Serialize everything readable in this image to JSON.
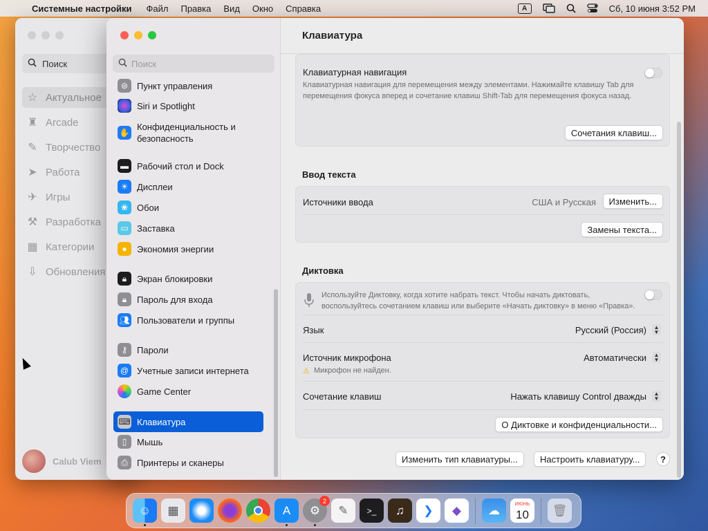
{
  "menubar": {
    "app_name": "Системные настройки",
    "menus": [
      "Файл",
      "Правка",
      "Вид",
      "Окно",
      "Справка"
    ],
    "input_indicator": "A",
    "datetime": "Сб, 10 июня  3:52 PM"
  },
  "bg_window": {
    "search_label": "Поиск",
    "items": [
      "Актуальное",
      "Arcade",
      "Творчество",
      "Работа",
      "Игры",
      "Разработка",
      "Категории",
      "Обновления"
    ],
    "user_name": "Calub Viem"
  },
  "sidebar": {
    "search_placeholder": "Поиск",
    "items": [
      {
        "label": "Пункт управления",
        "icon": "control-center-icon"
      },
      {
        "label": "Siri и Spotlight",
        "icon": "siri-icon"
      },
      {
        "label": "Конфиденциальность и безопасность",
        "icon": "privacy-hand-icon"
      },
      {
        "label": "Рабочий стол и Dock",
        "icon": "desktop-dock-icon"
      },
      {
        "label": "Дисплеи",
        "icon": "displays-sun-icon"
      },
      {
        "label": "Обои",
        "icon": "wallpaper-flower-icon"
      },
      {
        "label": "Заставка",
        "icon": "screensaver-icon"
      },
      {
        "label": "Экономия энергии",
        "icon": "energy-bulb-icon"
      },
      {
        "label": "Экран блокировки",
        "icon": "lock-screen-icon"
      },
      {
        "label": "Пароль для входа",
        "icon": "lock-password-icon"
      },
      {
        "label": "Пользователи и группы",
        "icon": "users-groups-icon"
      },
      {
        "label": "Пароли",
        "icon": "passwords-key-icon"
      },
      {
        "label": "Учетные записи интернета",
        "icon": "internet-accounts-icon"
      },
      {
        "label": "Game Center",
        "icon": "game-center-icon"
      },
      {
        "label": "Клавиатура",
        "icon": "keyboard-icon"
      },
      {
        "label": "Мышь",
        "icon": "mouse-icon"
      },
      {
        "label": "Принтеры и сканеры",
        "icon": "printer-icon"
      }
    ]
  },
  "content": {
    "title": "Клавиатура",
    "kbd_nav": {
      "label": "Клавиатурная навигация",
      "description": "Клавиатурная навигация для перемещения между элементами. Нажимайте клавишу Tab для перемещения фокуса вперед и сочетание клавиш Shift-Tab для перемещения фокуса назад.",
      "toggle_on": false,
      "shortcuts_button": "Сочетания клавиш..."
    },
    "text_input": {
      "header": "Ввод текста",
      "sources_label": "Источники ввода",
      "sources_value": "США и Русская",
      "change_button": "Изменить...",
      "replacements_button": "Замены текста..."
    },
    "dictation": {
      "header": "Диктовка",
      "description": "Используйте Диктовку, когда хотите набрать текст. Чтобы начать диктовать, воспользуйтесь сочетанием клавиш или выберите «Начать диктовку» в меню «Правка».",
      "toggle_on": false,
      "language_label": "Язык",
      "language_value": "Русский (Россия)",
      "mic_label": "Источник микрофона",
      "mic_value": "Автоматически",
      "mic_warning": "Микрофон не найден.",
      "shortcut_label": "Сочетание клавиш",
      "shortcut_value": "Нажать клавишу Control дважды",
      "privacy_button": "О Диктовке и конфиденциальности..."
    },
    "bottom": {
      "change_type_button": "Изменить тип клавиатуры...",
      "setup_button": "Настроить клавиатуру...",
      "help_button": "?"
    }
  },
  "dock": {
    "apps": [
      "finder-icon",
      "launchpad-icon",
      "safari-icon",
      "firefox-icon",
      "chrome-icon",
      "app-store-icon",
      "system-settings-icon",
      "textedit-icon",
      "terminal-icon",
      "instruments-icon",
      "vscode-icon",
      "visual-studio-icon",
      "weather-icon",
      "calendar-icon",
      "trash-icon"
    ],
    "settings_badge": "2",
    "calendar_month": "ИЮНЬ",
    "calendar_day": "10"
  },
  "colors": {
    "accent": "#0a5ed7",
    "close": "#fe5f57",
    "minimize": "#febc2e",
    "zoom": "#28c840"
  }
}
